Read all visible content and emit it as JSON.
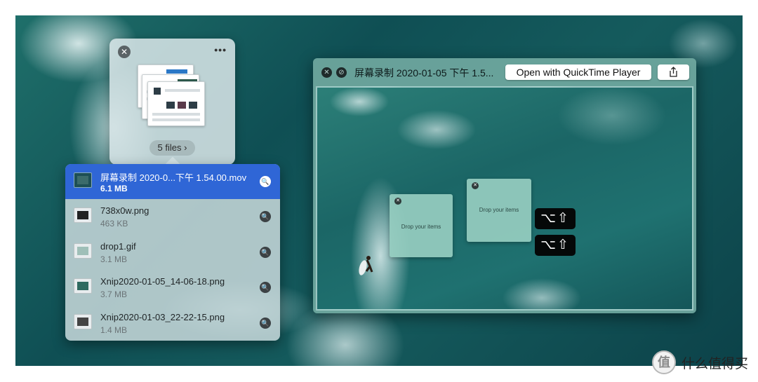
{
  "stack": {
    "files_label": "5 files ›",
    "more_label": "•••"
  },
  "files": [
    {
      "name": "屏幕录制 2020-0...下午 1.54.00.mov",
      "size": "6.1 MB"
    },
    {
      "name": "738x0w.png",
      "size": "463 KB"
    },
    {
      "name": "drop1.gif",
      "size": "3.1 MB"
    },
    {
      "name": "Xnip2020-01-05_14-06-18.png",
      "size": "3.7 MB"
    },
    {
      "name": "Xnip2020-01-03_22-22-15.png",
      "size": "1.4 MB"
    }
  ],
  "quicklook": {
    "title": "屏幕录制 2020-01-05 下午 1.5...",
    "open_button": "Open with QuickTime Player",
    "drop_label": "Drop your items",
    "shortcut": "⌥⇧"
  },
  "watermark": {
    "seal": "值",
    "text": "什么值得买"
  },
  "colors": {
    "selection": "#2f66d6",
    "panel": "#c4d6d8",
    "window": "#70a8a0"
  }
}
